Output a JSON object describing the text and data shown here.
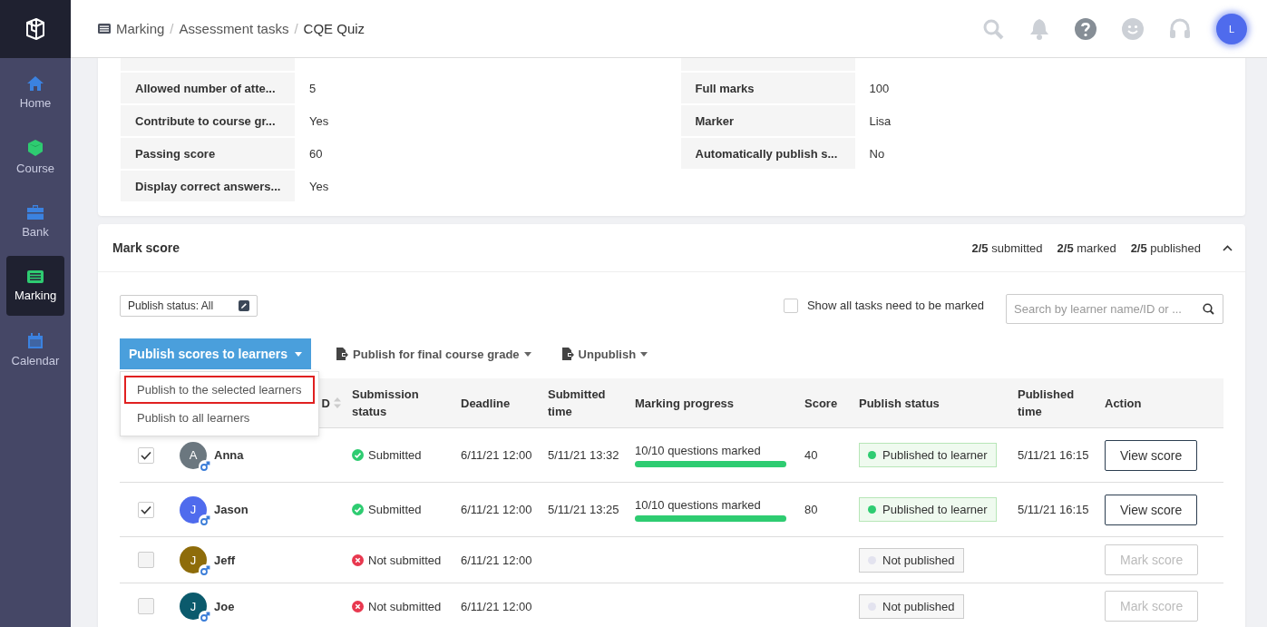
{
  "sidebar": {
    "items": [
      {
        "label": "Home",
        "selected": false
      },
      {
        "label": "Course",
        "selected": false
      },
      {
        "label": "Bank",
        "selected": false
      },
      {
        "label": "Marking",
        "selected": true
      },
      {
        "label": "Calendar",
        "selected": false
      }
    ]
  },
  "breadcrumb": [
    {
      "kind": "link",
      "text": "Marking"
    },
    {
      "kind": "separator",
      "text": "/"
    },
    {
      "kind": "link",
      "text": "Assessment tasks"
    },
    {
      "kind": "separator",
      "text": "/"
    },
    {
      "kind": "current",
      "text": "CQE Quiz"
    }
  ],
  "header": {
    "avatar": "L"
  },
  "info": {
    "left": [
      {
        "label": "Allowed number of atte...",
        "value": "5"
      },
      {
        "label": "Contribute to course gr...",
        "value": "Yes"
      },
      {
        "label": "Passing score",
        "value": "60"
      },
      {
        "label": "Display correct answers...",
        "value": "Yes"
      }
    ],
    "right": [
      {
        "label": "Full marks",
        "value": "100"
      },
      {
        "label": "Marker",
        "value": "Lisa"
      },
      {
        "label": "Automatically publish s...",
        "value": "No"
      }
    ]
  },
  "mark_score": {
    "title": "Mark score",
    "expanded": true,
    "summary": [
      "**2/5** submitted",
      "**2/5** marked",
      "**2/5** published"
    ],
    "filter": "Publish status: All",
    "show_all": {
      "label": "Show all tasks need to be marked",
      "checked": false
    },
    "search": {
      "placeholder": "Search by learner name/ID or ..."
    },
    "actions": [
      "Publish scores to learners",
      "Publish for final course grade",
      "Unpublish"
    ],
    "menu": [
      {
        "label": "Publish to the selected learners",
        "selected": true
      },
      {
        "label": "Publish to all learners",
        "selected": false
      }
    ],
    "columns": [
      "D",
      "Submission status",
      "Deadline",
      "Submitted time",
      "Marking progress",
      "Score",
      "Publish status",
      "Published time",
      "Action"
    ],
    "rows": [
      {
        "checked": true,
        "initial": "A",
        "name": "Anna",
        "color": "#6b777f",
        "status": {
          "kind": "submitted",
          "text": "Submitted"
        },
        "deadline": "6/11/21 12:00",
        "submitted": "5/11/21 13:32",
        "progress": {
          "text": "10/10 questions marked",
          "level": 1
        },
        "score": "40",
        "publish": {
          "kind": "published",
          "text": "Published to learner"
        },
        "published_time": "5/11/21 16:15",
        "action": {
          "label": "View score",
          "disabled": false
        }
      },
      {
        "checked": true,
        "initial": "J",
        "name": "Jason",
        "color": "#4f6bed",
        "status": {
          "kind": "submitted",
          "text": "Submitted"
        },
        "deadline": "6/11/21 12:00",
        "submitted": "5/11/21 13:25",
        "progress": {
          "text": "10/10 questions marked",
          "level": 1
        },
        "score": "80",
        "publish": {
          "kind": "published",
          "text": "Published to learner"
        },
        "published_time": "5/11/21 16:15",
        "action": {
          "label": "View score",
          "disabled": false
        }
      },
      {
        "checked": false,
        "initial": "J",
        "name": "Jeff",
        "color": "#8e6c0a",
        "status": {
          "kind": "not_submitted",
          "text": "Not submitted"
        },
        "deadline": "6/11/21 12:00",
        "publish": {
          "kind": "unpublished",
          "text": "Not published"
        },
        "action": {
          "label": "Mark score",
          "disabled": true
        }
      },
      {
        "checked": false,
        "initial": "J",
        "name": "Joe",
        "color": "#0b5a6c",
        "status": {
          "kind": "not_submitted",
          "text": "Not submitted"
        },
        "deadline": "6/11/21 12:00",
        "publish": {
          "kind": "unpublished",
          "text": "Not published"
        },
        "action": {
          "label": "Mark score",
          "disabled": true
        }
      }
    ]
  }
}
